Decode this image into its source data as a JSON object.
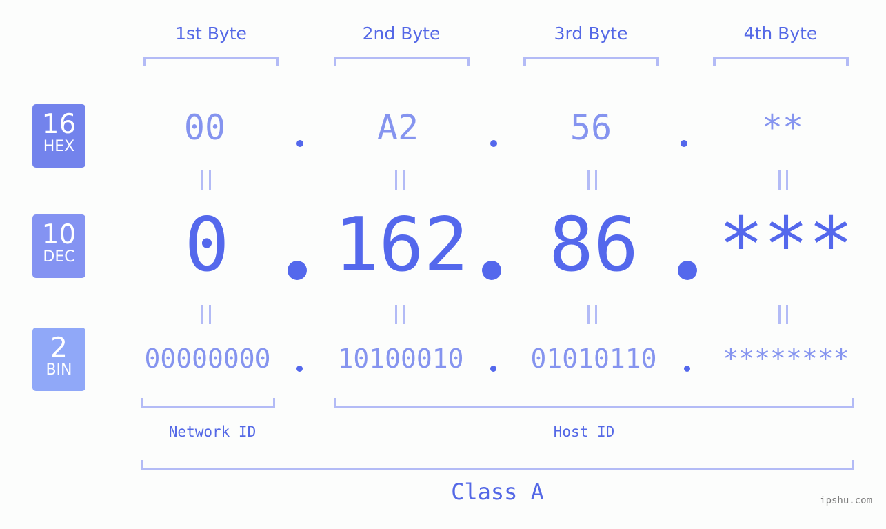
{
  "byte_headers": [
    "1st Byte",
    "2nd Byte",
    "3rd Byte",
    "4th Byte"
  ],
  "rows": {
    "hex": {
      "base": "16",
      "name": "HEX",
      "color": "#7383ec",
      "values": [
        "00",
        "A2",
        "56",
        "**"
      ]
    },
    "dec": {
      "base": "10",
      "name": "DEC",
      "color": "#8493f2",
      "values": [
        "0",
        "162",
        "86",
        "***"
      ]
    },
    "bin": {
      "base": "2",
      "name": "BIN",
      "color": "#90a8f8",
      "values": [
        "00000000",
        "10100010",
        "01010110",
        "********"
      ]
    }
  },
  "separator": ".",
  "segments": {
    "network": "Network ID",
    "host": "Host ID",
    "class": "Class A"
  },
  "watermark": "ipshu.com",
  "colors": {
    "accent": "#5468ec",
    "light_value": "#8594ef",
    "bracket": "#b3bbf6"
  }
}
